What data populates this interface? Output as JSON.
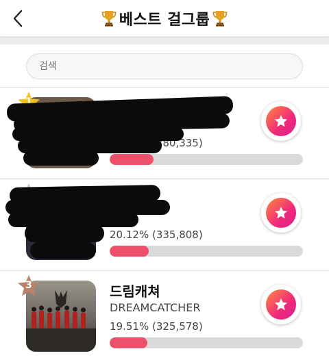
{
  "header": {
    "title": "베스트 걸그룹"
  },
  "search": {
    "placeholder": "검색"
  },
  "entries": [
    {
      "rank": "1",
      "name": "",
      "english_name": "",
      "stat": "22.79% (380,335)",
      "percent": 22.79
    },
    {
      "rank": "2",
      "name": "",
      "english_name": "",
      "stat": "20.12% (335,808)",
      "percent": 20.12
    },
    {
      "rank": "3",
      "name": "드림캐쳐",
      "english_name": "DREAMCATCHER",
      "stat": "19.51% (325,578)",
      "percent": 19.51
    }
  ],
  "colors": {
    "accent": "#ee4f6b",
    "bar_track": "#dadada",
    "rank1": "#f2c21d",
    "rank2": "#c6c6c6",
    "rank3": "#b9836a"
  },
  "icons": {
    "back": "chevron-left-icon",
    "trophy": "trophy-icon",
    "vote": "star-icon"
  }
}
